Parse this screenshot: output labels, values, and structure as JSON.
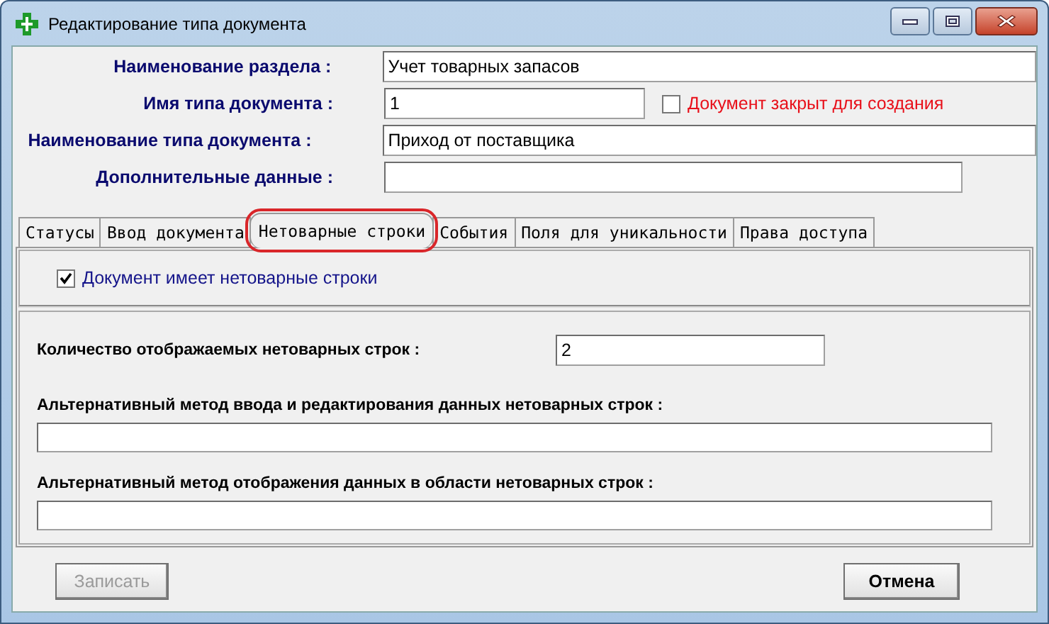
{
  "window": {
    "title": "Редактирование типа документа"
  },
  "fields": [
    {
      "label": "Наименование раздела :",
      "value": "Учет товарных запасов"
    },
    {
      "label": "Имя типа документа :",
      "value": "1"
    },
    {
      "label": "Наименование типа документа :",
      "value": "Приход от поставщика"
    },
    {
      "label": "Дополнительные данные :"
    }
  ],
  "closed_checkbox": {
    "label": "Документ закрыт для создания",
    "checked": false
  },
  "tabs": [
    {
      "label": "Статусы",
      "selected": false,
      "highlighted": false
    },
    {
      "label": "Ввод документа",
      "selected": false,
      "highlighted": false
    },
    {
      "label": "Нетоварные строки",
      "selected": true,
      "highlighted": true
    },
    {
      "label": "События",
      "selected": false,
      "highlighted": false
    },
    {
      "label": "Поля для уникальности",
      "selected": false,
      "highlighted": false
    },
    {
      "label": "Права доступа",
      "selected": false,
      "highlighted": false
    }
  ],
  "panel": {
    "has_rows_checkbox": {
      "label": "Документ имеет нетоварные строки",
      "checked": true
    },
    "count": {
      "label": "Количество отображаемых нетоварных строк :",
      "value": "2"
    },
    "alt_fields": [
      {
        "label": "Альтернативный метод ввода и редактирования данных нетоварных строк :"
      },
      {
        "label": "Альтернативный метод отображения данных в области нетоварных строк :"
      }
    ]
  },
  "buttons": [
    {
      "label": "Записать",
      "disabled": true,
      "default": false
    },
    {
      "label": "Отмена",
      "disabled": false,
      "default": true
    }
  ]
}
